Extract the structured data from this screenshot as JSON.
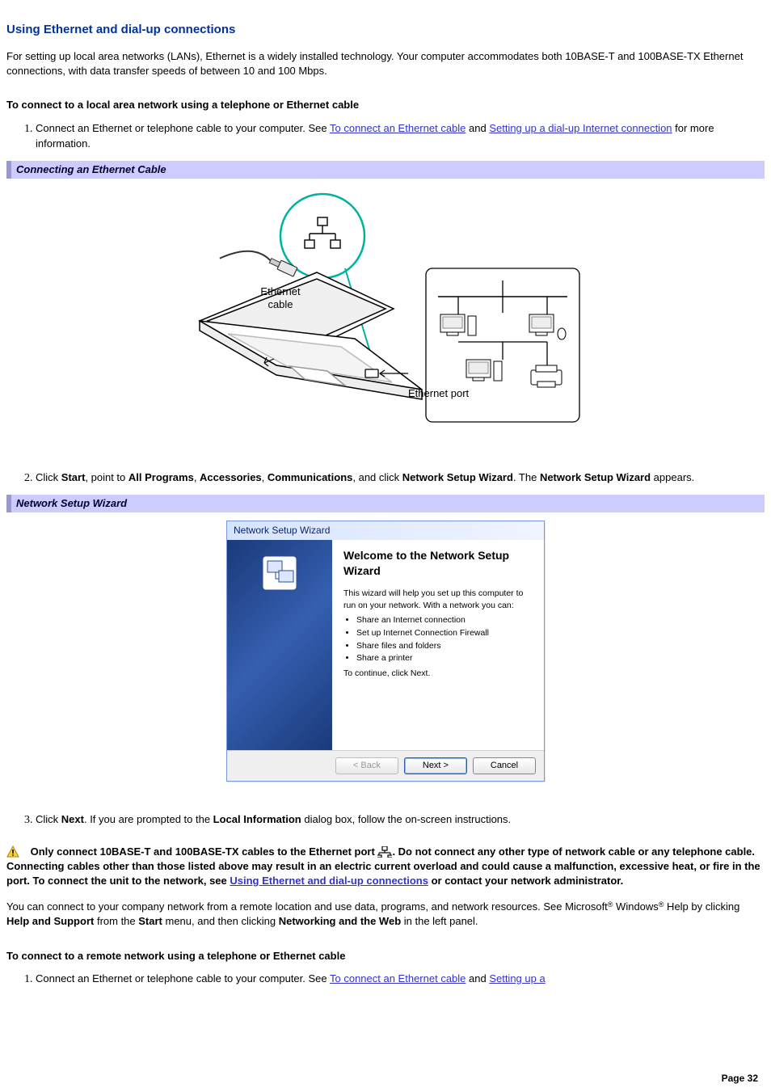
{
  "title": "Using Ethernet and dial-up connections",
  "intro": "For setting up local area networks (LANs), Ethernet is a widely installed technology. Your computer accommodates both 10BASE-T and 100BASE-TX Ethernet connections, with data transfer speeds of between 10 and 100 Mbps.",
  "sub1": "To connect to a local area network using a telephone or Ethernet cable",
  "step1_pre": "Connect an Ethernet or telephone cable to your computer. See ",
  "step1_link1": "To connect an Ethernet cable",
  "step1_mid": " and ",
  "step1_link2": "Setting up a dial-up Internet connection",
  "step1_post": " for more information.",
  "fig1_caption": "Connecting an Ethernet Cable",
  "fig1_label_cable": "Ethernet cable",
  "fig1_label_port": "Ethernet port",
  "step2_a": "Click ",
  "step2_b": "Start",
  "step2_c": ", point to ",
  "step2_d": "All Programs",
  "step2_e": ", ",
  "step2_f": "Accessories",
  "step2_g": ", ",
  "step2_h": "Communications",
  "step2_i": ", and click ",
  "step2_j": "Network Setup Wizard",
  "step2_k": ". The ",
  "step2_l": "Network Setup Wizard",
  "step2_m": " appears.",
  "fig2_caption": "Network Setup Wizard",
  "wizard": {
    "titlebar": "Network Setup Wizard",
    "heading": "Welcome to the Network Setup Wizard",
    "desc": "This wizard will help you set up this computer to run on your network. With a network you can:",
    "bullets": [
      "Share an Internet connection",
      "Set up Internet Connection Firewall",
      "Share files and folders",
      "Share a printer"
    ],
    "continue": "To continue, click Next.",
    "btn_back": "< Back",
    "btn_next": "Next >",
    "btn_cancel": "Cancel"
  },
  "step3_a": "Click ",
  "step3_b": "Next",
  "step3_c": ". If you are prompted to the ",
  "step3_d": "Local Information",
  "step3_e": " dialog box, follow the on-screen instructions.",
  "warn_a": "Only connect 10BASE-T and 100BASE-TX cables to the Ethernet port ",
  "warn_b": ". Do not connect any other type of network cable or any telephone cable. Connecting cables other than those listed above may result in an electric current overload and could cause a malfunction, excessive heat, or fire in the port. To connect the unit to the network, see ",
  "warn_link": "Using Ethernet and dial-up connections",
  "warn_c": " or contact your network administrator.",
  "remote_p_a": "You can connect to your company network from a remote location and use data, programs, and network resources. See Microsoft",
  "remote_p_b": " Windows",
  "remote_p_c": " Help by clicking ",
  "remote_p_d": "Help and Support",
  "remote_p_e": " from the ",
  "remote_p_f": "Start",
  "remote_p_g": " menu, and then clicking ",
  "remote_p_h": "Networking and the Web",
  "remote_p_i": " in the left panel.",
  "sub2": "To connect to a remote network using a telephone or Ethernet cable",
  "r_step1_pre": "Connect an Ethernet or telephone cable to your computer. See ",
  "r_step1_link1": "To connect an Ethernet cable",
  "r_step1_mid": " and ",
  "r_step1_link2": "Setting up a",
  "page_number": "Page 32"
}
